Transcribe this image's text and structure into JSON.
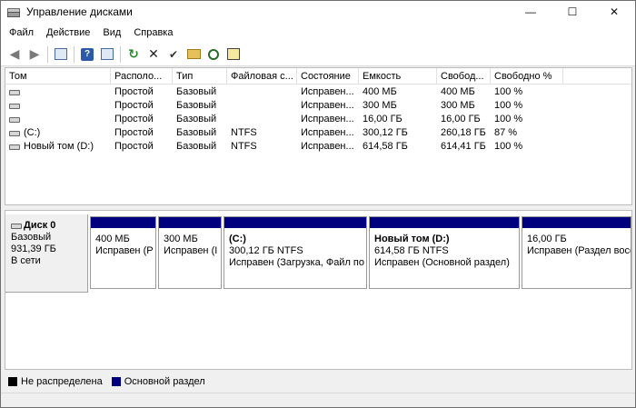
{
  "window": {
    "title": "Управление дисками",
    "buttons": {
      "minimize": "—",
      "maximize": "☐",
      "close": "✕"
    }
  },
  "menu": [
    "Файл",
    "Действие",
    "Вид",
    "Справка"
  ],
  "toolbar": {
    "icons": [
      "back-arrow-icon",
      "forward-arrow-icon",
      "console-tree-icon",
      "help-icon",
      "export-list-icon",
      "refresh-icon",
      "delete-icon",
      "check-icon",
      "open-folder-icon",
      "search-icon",
      "properties-icon"
    ]
  },
  "volumes": {
    "columns": [
      "Том",
      "Располо...",
      "Тип",
      "Файловая с...",
      "Состояние",
      "Емкость",
      "Свобод...",
      "Свободно %"
    ],
    "rows": [
      [
        "",
        "Простой",
        "Базовый",
        "",
        "Исправен...",
        "400 МБ",
        "400 МБ",
        "100 %"
      ],
      [
        "",
        "Простой",
        "Базовый",
        "",
        "Исправен...",
        "300 МБ",
        "300 МБ",
        "100 %"
      ],
      [
        "",
        "Простой",
        "Базовый",
        "",
        "Исправен...",
        "16,00 ГБ",
        "16,00 ГБ",
        "100 %"
      ],
      [
        "(C:)",
        "Простой",
        "Базовый",
        "NTFS",
        "Исправен...",
        "300,12 ГБ",
        "260,18 ГБ",
        "87 %"
      ],
      [
        "Новый том (D:)",
        "Простой",
        "Базовый",
        "NTFS",
        "Исправен...",
        "614,58 ГБ",
        "614,41 ГБ",
        "100 %"
      ]
    ]
  },
  "disk": {
    "name": "Диск 0",
    "type": "Базовый",
    "size": "931,39 ГБ",
    "status": "В сети",
    "partitions": [
      {
        "title": "",
        "size": "400 МБ",
        "status": "Исправен (Р"
      },
      {
        "title": "",
        "size": "300 МБ",
        "status": "Исправен (І"
      },
      {
        "title": "(C:)",
        "size": "300,12 ГБ NTFS",
        "status": "Исправен (Загрузка, Файл по"
      },
      {
        "title": "Новый том  (D:)",
        "size": "614,58 ГБ NTFS",
        "status": "Исправен (Основной раздел)"
      },
      {
        "title": "",
        "size": "16,00 ГБ",
        "status": "Исправен (Раздел восс"
      }
    ]
  },
  "legend": [
    {
      "label": "Не распределена",
      "color": "#000000"
    },
    {
      "label": "Основной раздел",
      "color": "#00007f"
    }
  ]
}
